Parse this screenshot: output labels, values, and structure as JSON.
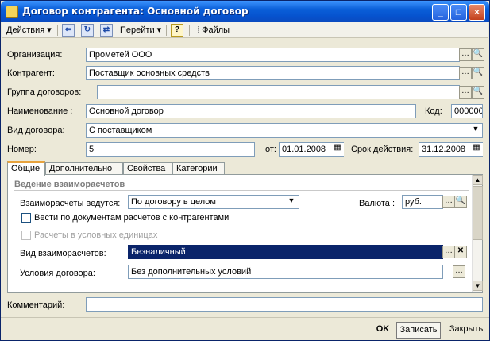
{
  "window": {
    "title": "Договор контрагента: Основной договор",
    "btn_min": "_",
    "btn_max": "□",
    "btn_close": "×"
  },
  "toolbar": {
    "actions": "Действия",
    "goto": "Перейти",
    "help": "?",
    "files": "Файлы"
  },
  "form": {
    "org_label": "Организация:",
    "org_value": "Прометей ООО",
    "counterparty_label": "Контрагент:",
    "counterparty_value": "Поставщик основных средств",
    "group_label": "Группа договоров:",
    "group_value": "",
    "name_label": "Наименование :",
    "name_value": "Основной договор",
    "code_label": "Код:",
    "code_value": "000000",
    "type_label": "Вид договора:",
    "type_value": "С поставщиком",
    "number_label": "Номер:",
    "number_value": "5",
    "date_label": "от:",
    "date_value": "01.01.2008",
    "term_label": "Срок действия:",
    "term_value": "31.12.2008"
  },
  "tabs": [
    "Общие",
    "Дополнительно",
    "Свойства",
    "Категории"
  ],
  "panel": {
    "section": "Ведение взаиморасчетов",
    "settlements_label": "Взаиморасчеты ведутся:",
    "settlements_value": "По договору в целом",
    "currency_label": "Валюта :",
    "currency_value": "руб.",
    "checkbox1": "Вести по документам расчетов с контрагентами",
    "checkbox2": "Расчеты в условных единицах",
    "payment_label": "Вид взаиморасчетов:",
    "payment_value": "Безналичный",
    "terms_label": "Условия договора:",
    "terms_value": "Без дополнительных условий"
  },
  "comment_label": "Комментарий:",
  "comment_value": "",
  "buttons": {
    "ok": "OK",
    "save": "Записать",
    "close": "Закрыть"
  }
}
